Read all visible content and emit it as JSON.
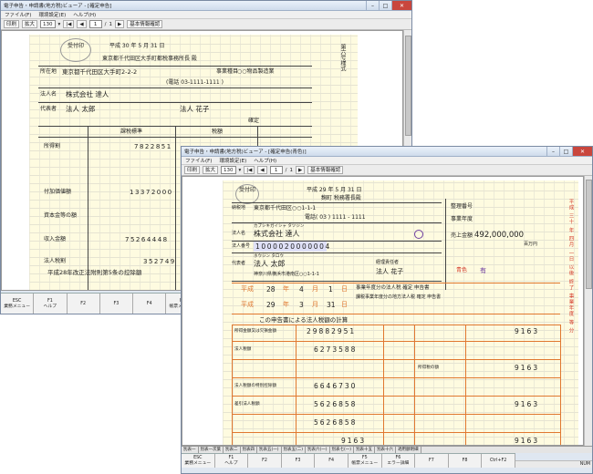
{
  "back_window": {
    "title": "電子申告・申請書(地方税)ビューア - [確定申告]",
    "menu": [
      "ファイル(F)",
      "環境設定(E)",
      "ヘルプ(H)"
    ],
    "toolbar": {
      "print": "印刷",
      "zoom": "拡大",
      "zoom_value": "130",
      "page_current": "1",
      "page_sep": "/",
      "page_total": "1",
      "basic_info": "基本情報確認"
    },
    "form": {
      "receipt": "受付印",
      "date": "平成 30 年 5 月 31 日",
      "addressee": "東京都千代田区大手町都税事務所長 殿",
      "address_label": "所在地",
      "address": "東京都千代田区大手町2-2-2",
      "phone": "(電話 03-1111-1111 )",
      "corp_label": "法人名",
      "corp_name": "株式会社 達人",
      "rep_label": "代表者",
      "rep_name": "法人 太郎",
      "acct_name": "法人 花子",
      "biz_type": "○○物品製造業",
      "biz_label": "事業種目",
      "declaration": "確定",
      "col_tax_base": "課税標準",
      "col_tax_amount": "税額",
      "amounts": [
        "7822851",
        "13372000",
        "75264448",
        "352749"
      ],
      "note": "平成28年改正法附則第5条の控除額",
      "side_title": "第六号様式",
      "rows": [
        "所得割",
        "付加価値額",
        "資本金等の額",
        "収入金額",
        "法人税割"
      ]
    },
    "fkeys": [
      {
        "key": "ESC",
        "label": "業務メニュー"
      },
      {
        "key": "F1",
        "label": "ヘルプ"
      },
      {
        "key": "F2",
        "label": ""
      },
      {
        "key": "F3",
        "label": ""
      },
      {
        "key": "F4",
        "label": ""
      },
      {
        "key": "F5",
        "label": "帳票メニュー"
      },
      {
        "key": "F6",
        "label": ""
      },
      {
        "key": "F7",
        "label": ""
      }
    ]
  },
  "front_window": {
    "title": "電子申告・申請書(地方税)ビューア - [確定申告(青色)]",
    "menu": [
      "ファイル(F)",
      "環境設定(E)",
      "ヘルプ(H)"
    ],
    "toolbar": {
      "print": "印刷",
      "zoom": "拡大",
      "zoom_value": "130",
      "page_current": "1",
      "page_sep": "/",
      "page_total": "1",
      "basic_info": "基本情報確認"
    },
    "form": {
      "receipt": "受付印",
      "date": "平成 29 年 5 月 31 日",
      "tax_office": "麹町 税務署長殿",
      "address_label": "納税地",
      "address": "東京都千代田区○○1-1-1",
      "phone": "電話( 03 ) 1111 - 1111",
      "corp_kana": "カブシキガイシャ タツジン",
      "corp_label": "法人名",
      "corp_name": "株式会社 達人",
      "corp_number_label": "法人番号",
      "corp_number": "1000020000004",
      "rep_kana": "ホウジン タロウ",
      "rep_label": "代表者",
      "rep_name": "法人 太郎",
      "rep_address": "神奈川県横浜市港南区○○1-1-1",
      "acct_label": "経理責任者",
      "acct_name": "法人 花子",
      "reg_no_label": "整理番号",
      "biz_year_label": "事業年度",
      "sales_label": "売上金額",
      "sales": "492,000,000",
      "unit": "百万円",
      "period_from": [
        "平成",
        "28",
        "年",
        "4",
        "月",
        "1",
        "日"
      ],
      "period_to": [
        "平成",
        "29",
        "年",
        "3",
        "月",
        "31",
        "日"
      ],
      "declaration": "事業年度分の法人税 確定 申告書",
      "declaration2": "課税事業年度分の地方法人税 確定 申告書",
      "section_title": "この申告書による法人税額の計算",
      "side_text": "平成 三十 年 四月 一日 以後 終了 事業年度 等 分",
      "amounts": [
        "29882951",
        "6273588",
        "6646730",
        "5626858",
        "5626858",
        "9163"
      ],
      "right_amounts": [
        "9163",
        "9163",
        "9163",
        "9163"
      ],
      "rows": [
        "所得金額又は欠損金額",
        "法人税額",
        "法人税額の特別控除額",
        "差引法人税額",
        "所得税の額"
      ],
      "filed": "有",
      "blue": "青色"
    },
    "tabs": [
      "別表一",
      "別表一次葉",
      "別表二",
      "別表四",
      "別表五(一)",
      "別表五(二)",
      "別表六(一)",
      "別表七(一)",
      "別表十五",
      "別表十六",
      "適用額明細"
    ],
    "fkeys": [
      {
        "key": "ESC",
        "label": "業務メニュー"
      },
      {
        "key": "F1",
        "label": "ヘルプ"
      },
      {
        "key": "F2",
        "label": ""
      },
      {
        "key": "F3",
        "label": ""
      },
      {
        "key": "F4",
        "label": ""
      },
      {
        "key": "F5",
        "label": "帳票メニュー"
      },
      {
        "key": "F6",
        "label": "エラー詳細"
      },
      {
        "key": "F7",
        "label": ""
      },
      {
        "key": "F8",
        "label": ""
      },
      {
        "key": "Ctrl+F2",
        "label": ""
      }
    ],
    "status": "NUM"
  },
  "colors": {
    "accent": "#e07830",
    "red": "#d43a2a",
    "title_bar": "#cfdcec"
  }
}
